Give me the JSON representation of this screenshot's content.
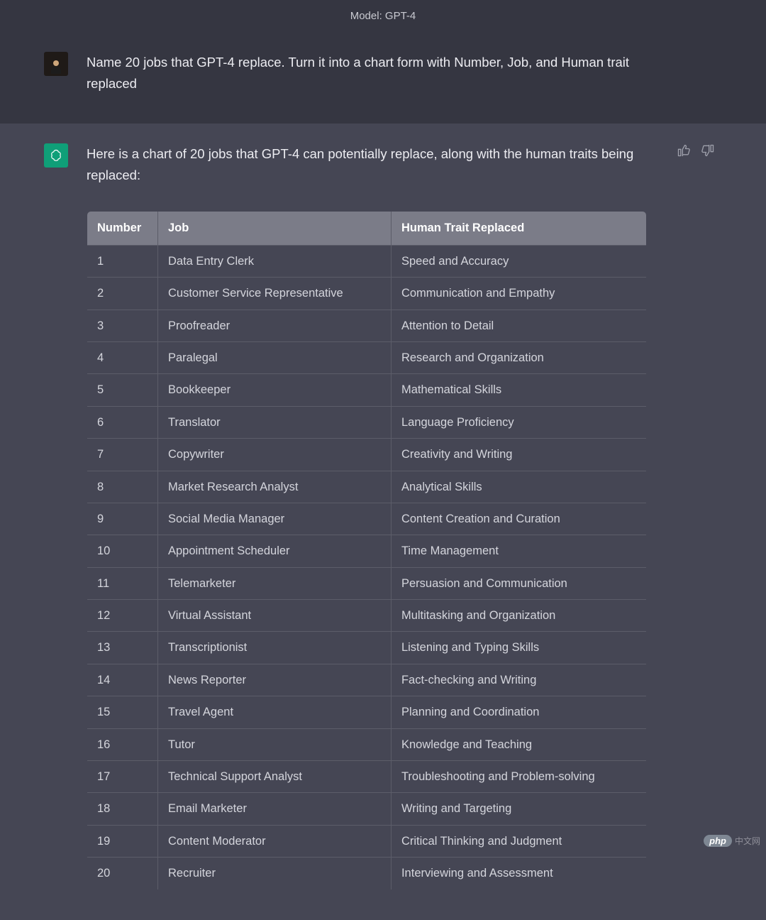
{
  "model_bar": "Model: GPT-4",
  "user_message": "Name 20 jobs that GPT-4 replace. Turn it into a chart form with Number, Job, and Human trait replaced",
  "assistant_intro": "Here is a chart of 20 jobs that GPT-4 can potentially replace, along with the human traits being replaced:",
  "table": {
    "headers": [
      "Number",
      "Job",
      "Human Trait Replaced"
    ],
    "rows": [
      {
        "n": "1",
        "job": "Data Entry Clerk",
        "trait": "Speed and Accuracy"
      },
      {
        "n": "2",
        "job": "Customer Service Representative",
        "trait": "Communication and Empathy"
      },
      {
        "n": "3",
        "job": "Proofreader",
        "trait": "Attention to Detail"
      },
      {
        "n": "4",
        "job": "Paralegal",
        "trait": "Research and Organization"
      },
      {
        "n": "5",
        "job": "Bookkeeper",
        "trait": "Mathematical Skills"
      },
      {
        "n": "6",
        "job": "Translator",
        "trait": "Language Proficiency"
      },
      {
        "n": "7",
        "job": "Copywriter",
        "trait": "Creativity and Writing"
      },
      {
        "n": "8",
        "job": "Market Research Analyst",
        "trait": "Analytical Skills"
      },
      {
        "n": "9",
        "job": "Social Media Manager",
        "trait": "Content Creation and Curation"
      },
      {
        "n": "10",
        "job": "Appointment Scheduler",
        "trait": "Time Management"
      },
      {
        "n": "11",
        "job": "Telemarketer",
        "trait": "Persuasion and Communication"
      },
      {
        "n": "12",
        "job": "Virtual Assistant",
        "trait": "Multitasking and Organization"
      },
      {
        "n": "13",
        "job": "Transcriptionist",
        "trait": "Listening and Typing Skills"
      },
      {
        "n": "14",
        "job": "News Reporter",
        "trait": "Fact-checking and Writing"
      },
      {
        "n": "15",
        "job": "Travel Agent",
        "trait": "Planning and Coordination"
      },
      {
        "n": "16",
        "job": "Tutor",
        "trait": "Knowledge and Teaching"
      },
      {
        "n": "17",
        "job": "Technical Support Analyst",
        "trait": "Troubleshooting and Problem-solving"
      },
      {
        "n": "18",
        "job": "Email Marketer",
        "trait": "Writing and Targeting"
      },
      {
        "n": "19",
        "job": "Content Moderator",
        "trait": "Critical Thinking and Judgment"
      },
      {
        "n": "20",
        "job": "Recruiter",
        "trait": "Interviewing and Assessment"
      }
    ]
  },
  "watermark": {
    "badge": "php",
    "text": "中文网"
  },
  "chart_data": {
    "type": "table",
    "title": "20 jobs GPT-4 can potentially replace",
    "columns": [
      "Number",
      "Job",
      "Human Trait Replaced"
    ],
    "rows": [
      [
        1,
        "Data Entry Clerk",
        "Speed and Accuracy"
      ],
      [
        2,
        "Customer Service Representative",
        "Communication and Empathy"
      ],
      [
        3,
        "Proofreader",
        "Attention to Detail"
      ],
      [
        4,
        "Paralegal",
        "Research and Organization"
      ],
      [
        5,
        "Bookkeeper",
        "Mathematical Skills"
      ],
      [
        6,
        "Translator",
        "Language Proficiency"
      ],
      [
        7,
        "Copywriter",
        "Creativity and Writing"
      ],
      [
        8,
        "Market Research Analyst",
        "Analytical Skills"
      ],
      [
        9,
        "Social Media Manager",
        "Content Creation and Curation"
      ],
      [
        10,
        "Appointment Scheduler",
        "Time Management"
      ],
      [
        11,
        "Telemarketer",
        "Persuasion and Communication"
      ],
      [
        12,
        "Virtual Assistant",
        "Multitasking and Organization"
      ],
      [
        13,
        "Transcriptionist",
        "Listening and Typing Skills"
      ],
      [
        14,
        "News Reporter",
        "Fact-checking and Writing"
      ],
      [
        15,
        "Travel Agent",
        "Planning and Coordination"
      ],
      [
        16,
        "Tutor",
        "Knowledge and Teaching"
      ],
      [
        17,
        "Technical Support Analyst",
        "Troubleshooting and Problem-solving"
      ],
      [
        18,
        "Email Marketer",
        "Writing and Targeting"
      ],
      [
        19,
        "Content Moderator",
        "Critical Thinking and Judgment"
      ],
      [
        20,
        "Recruiter",
        "Interviewing and Assessment"
      ]
    ]
  }
}
